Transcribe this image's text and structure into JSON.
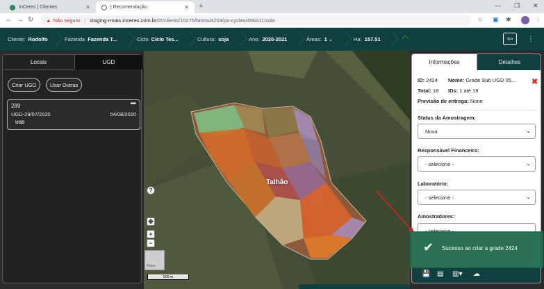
{
  "browser": {
    "tabs": [
      {
        "title": "InCeres | Clientes"
      },
      {
        "title": "| Recomendação"
      }
    ],
    "security_label": "Não seguro",
    "url_host": "staging-rmais.inceres.com.br",
    "url_path": "/#!/clients/10275/farms/4204/pa-cycles/456311/solo"
  },
  "header": {
    "cliente_label": "Cliente:",
    "cliente_value": "Rodolfo",
    "fazenda_label": "Fazenda",
    "fazenda_value": "Fazenda T...",
    "ciclo_label": "Ciclo",
    "ciclo_value": "Ciclo Tes...",
    "cultura_label": "Cultura:",
    "cultura_value": "soja",
    "ano_label": "Ano:",
    "ano_value": "2020-2021",
    "areas_label": "Áreas:",
    "areas_value": "1",
    "ha_label": "Ha:",
    "ha_value": "157.51"
  },
  "left": {
    "tabs": [
      "Locais",
      "UGD"
    ],
    "buttons": [
      "Criar UGD",
      "Usar Outras"
    ],
    "card": {
      "id": "289",
      "name": "UGD-29/07/2020",
      "date": "04/08/2020",
      "badge": "UGD"
    }
  },
  "map": {
    "label": "Talhão",
    "help": "?",
    "zoom_in": "+",
    "zoom_out": "−",
    "scale": "500 m",
    "thumb": "Mapa"
  },
  "right": {
    "tabs": [
      "Informações",
      "Detalhes"
    ],
    "id_label": "ID:",
    "id_value": "2424",
    "nome_label": "Nome:",
    "nome_value": "Grade Sub UGD 05...",
    "total_label": "Total:",
    "total_value": "18",
    "ids_label": "IDs:",
    "ids_value": "1 até 18",
    "previsao_label": "Previsão de entrega:",
    "previsao_value": "None",
    "status_label": "Status da Amostragem:",
    "status_value": "Nova",
    "resp_label": "Responsável Financeiro:",
    "resp_value": "- selecione -",
    "lab_label": "Laboratório:",
    "lab_value": "- selecione -",
    "amostr_label": "Amostradores:",
    "amostr_value": "- selecione -"
  },
  "toast": {
    "message": "Sucesso ao criar a grade 2424"
  },
  "colors": {
    "header": "#0f3f3f",
    "toast": "#1f6a4b",
    "close": "#d93025",
    "wifi": "#19b33d"
  }
}
